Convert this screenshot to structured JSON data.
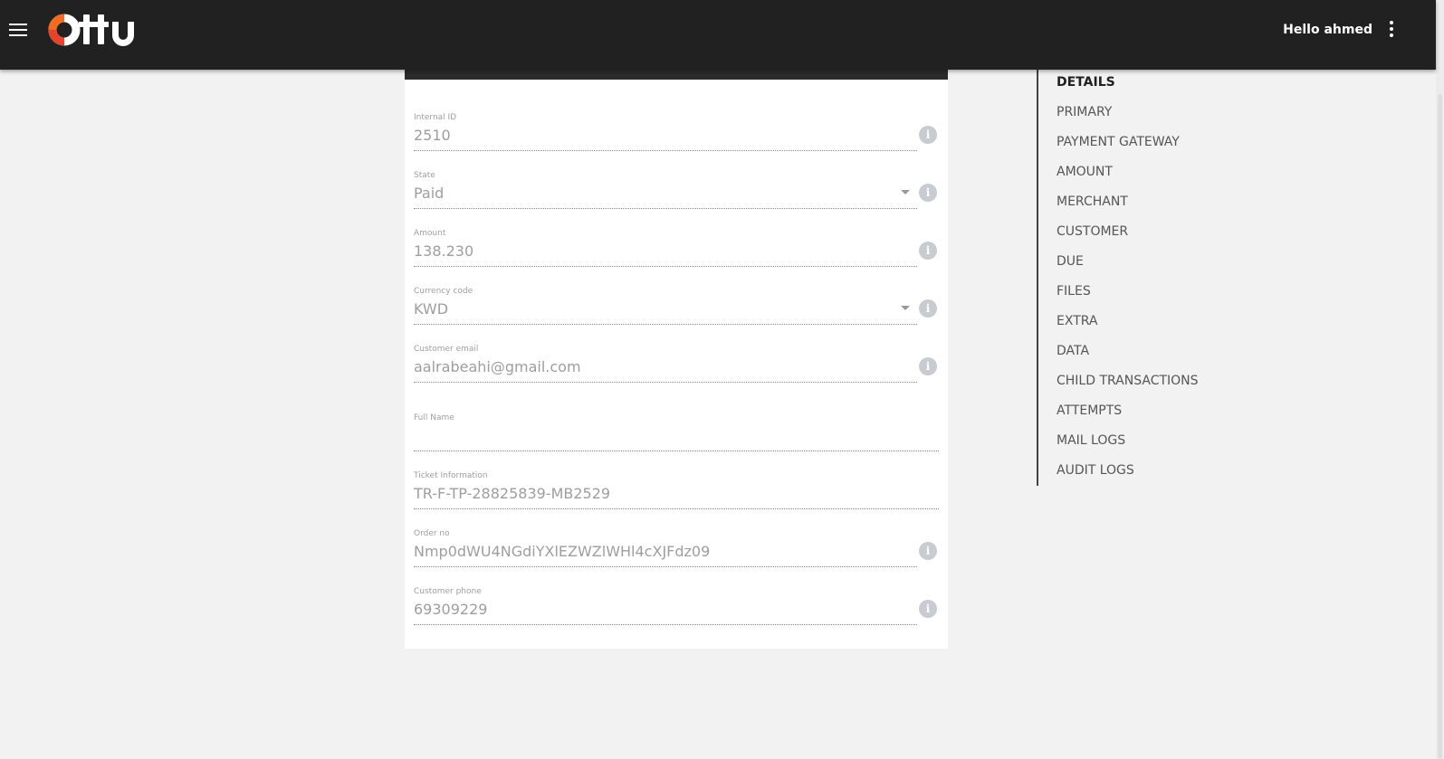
{
  "header": {
    "logo_text": "Ottu",
    "greeting": "Hello ahmed",
    "menu_icon": "hamburger-menu-icon",
    "more_icon": "more-vert-icon"
  },
  "form": {
    "fields": [
      {
        "label": "Internal ID",
        "value": "2510"
      },
      {
        "label": "State",
        "value": "Paid"
      },
      {
        "label": "Amount",
        "value": "138.230"
      },
      {
        "label": "Currency code",
        "value": "KWD"
      },
      {
        "label": "Customer email",
        "value": "aalrabeahi@gmail.com"
      },
      {
        "label": "Full Name",
        "value": ""
      },
      {
        "label": "Ticket Information",
        "value": "TR-F-TP-28825839-MB2529"
      },
      {
        "label": "Order no",
        "value": "Nmp0dWU4NGdiYXlEZWZlWHl4cXJFdz09"
      },
      {
        "label": "Customer phone",
        "value": "69309229"
      }
    ],
    "info_glyph": "i"
  },
  "sidenav": {
    "items": [
      {
        "label": "DETAILS",
        "active": true
      },
      {
        "label": "PRIMARY"
      },
      {
        "label": "PAYMENT GATEWAY"
      },
      {
        "label": "AMOUNT"
      },
      {
        "label": "MERCHANT"
      },
      {
        "label": "CUSTOMER"
      },
      {
        "label": "DUE"
      },
      {
        "label": "FILES"
      },
      {
        "label": "EXTRA"
      },
      {
        "label": "DATA"
      },
      {
        "label": "CHILD TRANSACTIONS"
      },
      {
        "label": "ATTEMPTS"
      },
      {
        "label": "MAIL LOGS"
      },
      {
        "label": "AUDIT LOGS"
      }
    ]
  },
  "colors": {
    "header_bg": "#212121",
    "logo_accent": "#e8432a",
    "page_bg": "#f2f2f2",
    "info_icon": "#c8ccd0"
  }
}
